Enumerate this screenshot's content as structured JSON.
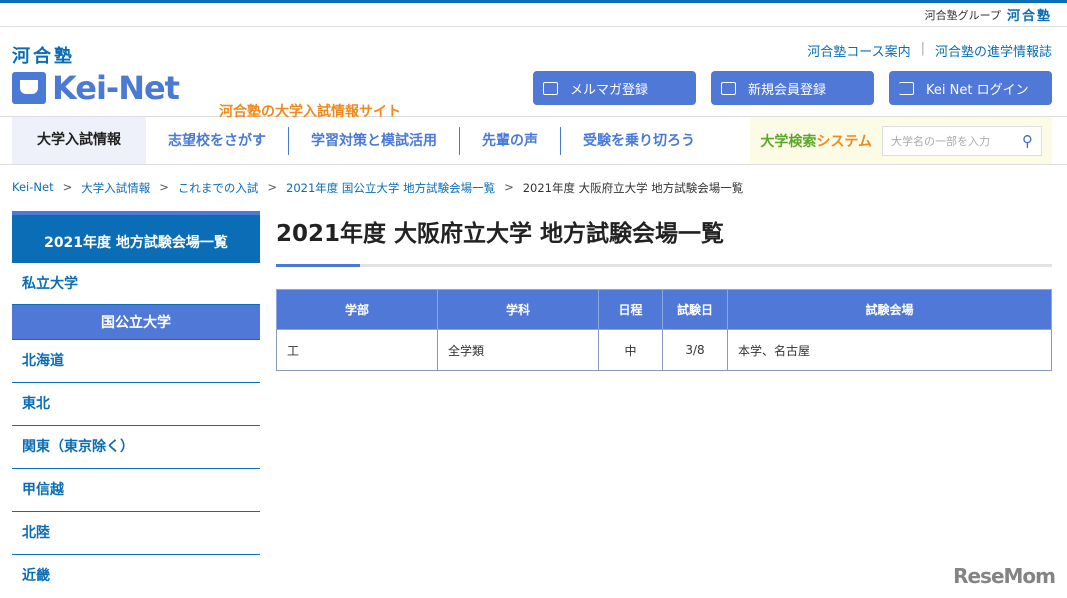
{
  "group": {
    "label": "河合塾グループ",
    "brand": "河合塾"
  },
  "header": {
    "kawai": "河合塾",
    "logo_main": "Kei-",
    "logo_net": "Net",
    "tagline": "河合塾の大学入試情報サイト",
    "links": [
      "河合塾コース案内",
      "河合塾の進学情報誌"
    ],
    "buttons": [
      {
        "icon": "mail-icon",
        "label": "メルマガ登録"
      },
      {
        "icon": "user-icon",
        "label": "新規会員登録"
      },
      {
        "icon": "login-icon",
        "label": "Kei Net ログイン"
      }
    ]
  },
  "nav": {
    "items": [
      "大学入試情報",
      "志望校をさがす",
      "学習対策と模試活用",
      "先輩の声",
      "受験を乗り切ろう"
    ],
    "system_a": "大学検索",
    "system_b": "システム",
    "search_placeholder": "大学名の一部を入力"
  },
  "breadcrumb": [
    "Kei-Net",
    "大学入試情報",
    "これまでの入試",
    "2021年度 国公立大学 地方試験会場一覧",
    "2021年度 大阪府立大学 地方試験会場一覧"
  ],
  "sidebar": {
    "title": "2021年度 地方試験会場一覧",
    "private": "私立大学",
    "public": "国公立大学",
    "regions": [
      "北海道",
      "東北",
      "関東（東京除く）",
      "甲信越",
      "北陸",
      "近畿"
    ]
  },
  "main": {
    "title": "2021年度 大阪府立大学 地方試験会場一覧",
    "headers": [
      "学部",
      "学科",
      "日程",
      "試験日",
      "試験会場"
    ],
    "rows": [
      [
        "工",
        "全学類",
        "中",
        "3/8",
        "本学、名古屋"
      ]
    ]
  },
  "watermark": "ReseMom"
}
